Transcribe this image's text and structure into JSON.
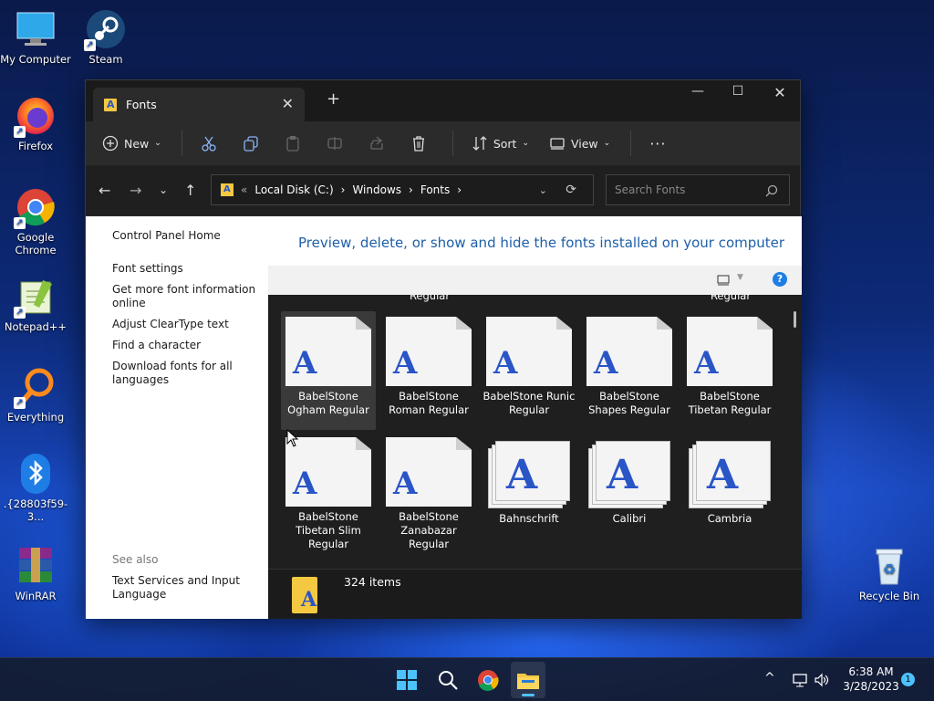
{
  "desktop": {
    "icons": [
      {
        "label": "My Computer"
      },
      {
        "label": "Steam"
      },
      {
        "label": "Firefox"
      },
      {
        "label": "Google Chrome"
      },
      {
        "label": "Notepad++"
      },
      {
        "label": "Everything"
      },
      {
        "label": ".{28803f59-3..."
      },
      {
        "label": "WinRAR"
      },
      {
        "label": "Recycle Bin"
      }
    ]
  },
  "window": {
    "tab_title": "Fonts",
    "new_tab": "+",
    "toolbar": {
      "new_label": "New",
      "sort_label": "Sort",
      "view_label": "View",
      "more": "···"
    },
    "address": {
      "crumbs": [
        "«",
        "Local Disk (C:)",
        "›",
        "Windows",
        "›",
        "Fonts",
        "›"
      ]
    },
    "search": {
      "placeholder": "Search Fonts"
    },
    "left_pane": {
      "links": [
        "Control Panel Home",
        "Font settings",
        "Get more font information online",
        "Adjust ClearType text",
        "Find a character",
        "Download fonts for all languages"
      ],
      "see_also": "See also",
      "see_also_links": [
        "Text Services and Input Language"
      ]
    },
    "main": {
      "heading": "Preview, delete, or show and hide the fonts installed on your computer",
      "help": "?",
      "top_row_labels": [
        "Regular",
        "Regular"
      ],
      "fonts": [
        {
          "name": "BabelStone Ogham Regular",
          "kind": "single",
          "selected": true
        },
        {
          "name": "BabelStone Roman Regular",
          "kind": "single"
        },
        {
          "name": "BabelStone Runic Regular",
          "kind": "single"
        },
        {
          "name": "BabelStone Shapes Regular",
          "kind": "single"
        },
        {
          "name": "BabelStone Tibetan Regular",
          "kind": "single"
        },
        {
          "name": "BabelStone Tibetan Slim Regular",
          "kind": "single"
        },
        {
          "name": "BabelStone Zanabazar Regular",
          "kind": "single"
        },
        {
          "name": "Bahnschrift",
          "kind": "family"
        },
        {
          "name": "Calibri",
          "kind": "family"
        },
        {
          "name": "Cambria",
          "kind": "family"
        }
      ],
      "glyph": "A",
      "status_count": "324 items"
    }
  },
  "taskbar": {
    "time": "6:38 AM",
    "date": "3/28/2023",
    "notification_count": "1",
    "tray_chevron": "^"
  },
  "colors": {
    "accent": "#1e5fa8",
    "window_dark": "#1f1f1f",
    "folder_yellow": "#f5c842",
    "glyph_blue": "#2a55c6"
  }
}
